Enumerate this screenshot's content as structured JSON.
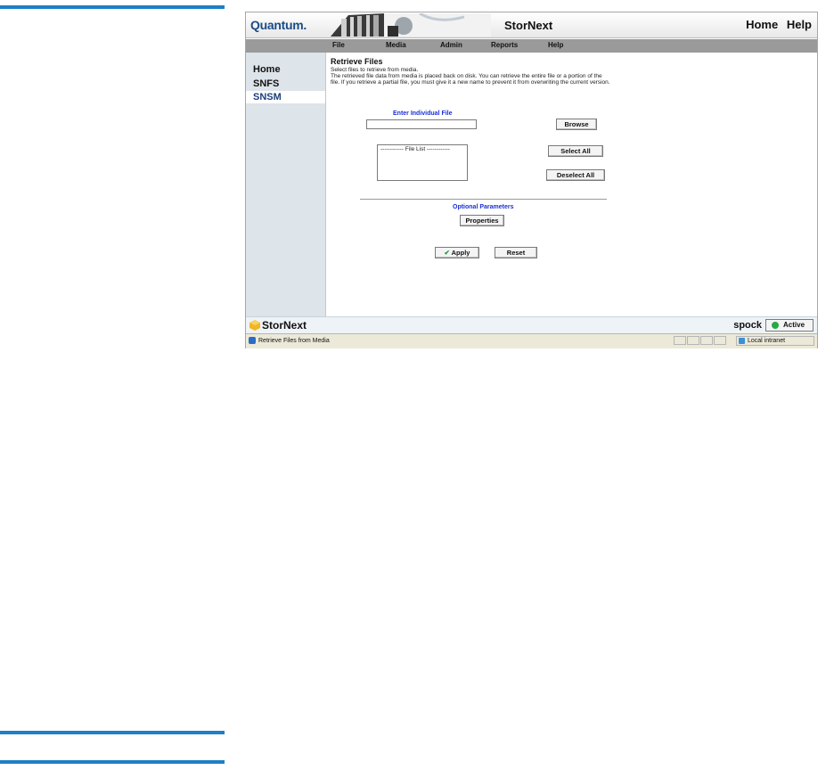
{
  "app": {
    "logo": "Quantum",
    "logo_dot": ".",
    "title": "StorNext",
    "top_links": [
      "Home",
      "Help"
    ]
  },
  "menu": [
    "File",
    "Media",
    "Admin",
    "Reports",
    "Help"
  ],
  "sidebar": {
    "items": [
      "Home",
      "SNFS",
      "SNSM"
    ],
    "selected": "SNSM"
  },
  "content": {
    "title": "Retrieve Files",
    "desc_line1": "Select files to retrieve from media.",
    "desc_line2": "The retrieved file data from media is placed back on disk. You can retrieve the entire file or a portion of the",
    "desc_line3": "file. If you retrieve a partial file, you must give it a new name to prevent it from overwriting the current version.",
    "enter_label": "Enter Individual File",
    "file_input_value": "",
    "file_list_text": "------------ File List ------------",
    "browse": "Browse",
    "select_all": "Select All",
    "deselect_all": "Deselect All",
    "optional_label": "Optional Parameters",
    "properties": "Properties",
    "apply": "Apply",
    "reset": "Reset"
  },
  "footer": {
    "brand": "StorNext",
    "host": "spock",
    "status": "Active"
  },
  "statusbar": {
    "text": "Retrieve Files from Media",
    "zone": "Local intranet"
  },
  "colors": {
    "accent_rule": "#1f7fc4",
    "label_blue": "#1a2fd6",
    "active_green": "#27a846"
  }
}
